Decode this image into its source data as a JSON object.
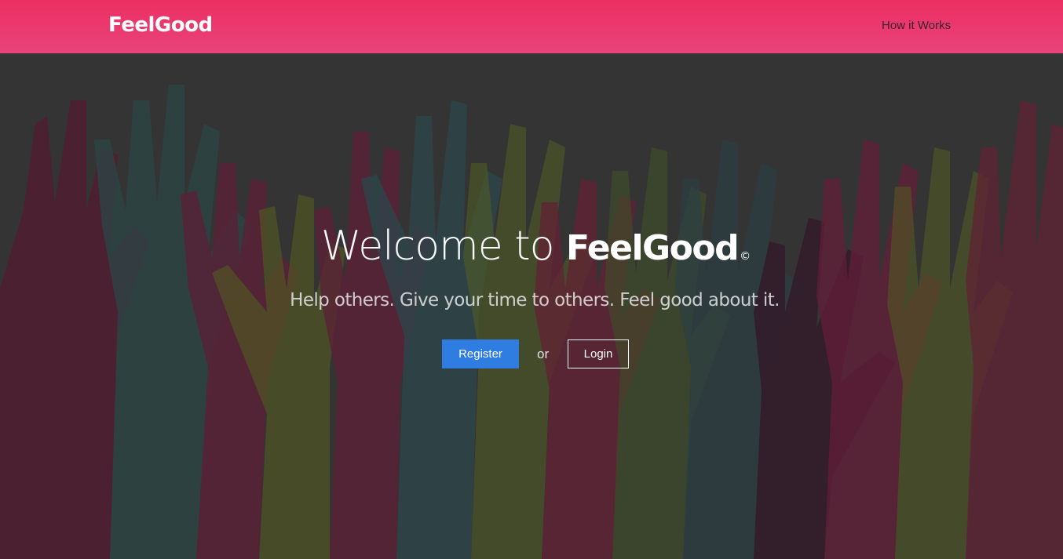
{
  "header": {
    "brand": "FeelGood",
    "nav_links": [
      {
        "label": "How it Works"
      }
    ]
  },
  "hero": {
    "headline_prefix": "Welcome to",
    "headline_brand": "FeelGood",
    "headline_mark": "©",
    "tagline": "Help others. Give your time to others. Feel good about it.",
    "register_label": "Register",
    "or_label": "or",
    "login_label": "Login",
    "background_image": "raised-hands-illustration"
  },
  "colors": {
    "navbar": "#ec2f63",
    "register_button": "#2f7de1",
    "text": "#ffffff"
  }
}
